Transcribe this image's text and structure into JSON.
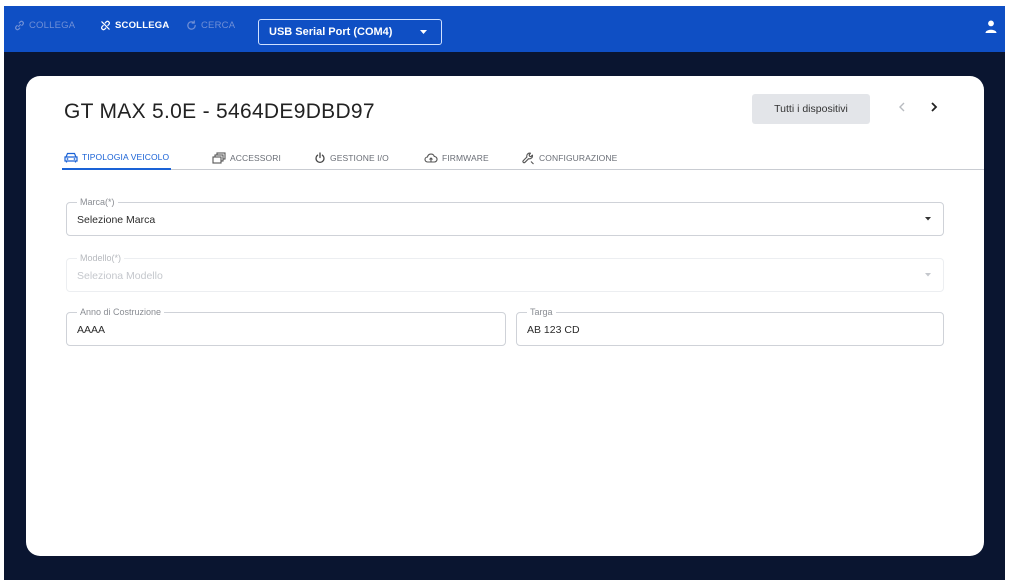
{
  "topbar": {
    "collega_label": "COLLEGA",
    "scollega_label": "SCOLLEGA",
    "cerca_label": "CERCA",
    "port_value": "USB Serial Port (COM4)",
    "bar_color": "#0f4fc4"
  },
  "device": {
    "title": "GT MAX 5.0E - 5464DE9DBD97",
    "all_devices_label": "Tutti i dispositivi"
  },
  "tabs": [
    {
      "label": "TIPOLOGIA VEICOLO",
      "active": true,
      "icon": "car-icon"
    },
    {
      "label": "ACCESSORI",
      "active": false,
      "icon": "layers-icon"
    },
    {
      "label": "GESTIONE I/O",
      "active": false,
      "icon": "power-icon"
    },
    {
      "label": "FIRMWARE",
      "active": false,
      "icon": "cloud-icon"
    },
    {
      "label": "CONFIGURAZIONE",
      "active": false,
      "icon": "wrench-icon"
    }
  ],
  "form": {
    "marca": {
      "label": "Marca(*)",
      "value": "Selezione Marca"
    },
    "modello": {
      "label": "Modello(*)",
      "value": "Seleziona Modello"
    },
    "anno": {
      "label": "Anno di Costruzione",
      "value": "AAAA"
    },
    "targa": {
      "label": "Targa",
      "value": "AB 123 CD"
    }
  },
  "colors": {
    "accent": "#1a62d6",
    "background": "#0a1530"
  }
}
